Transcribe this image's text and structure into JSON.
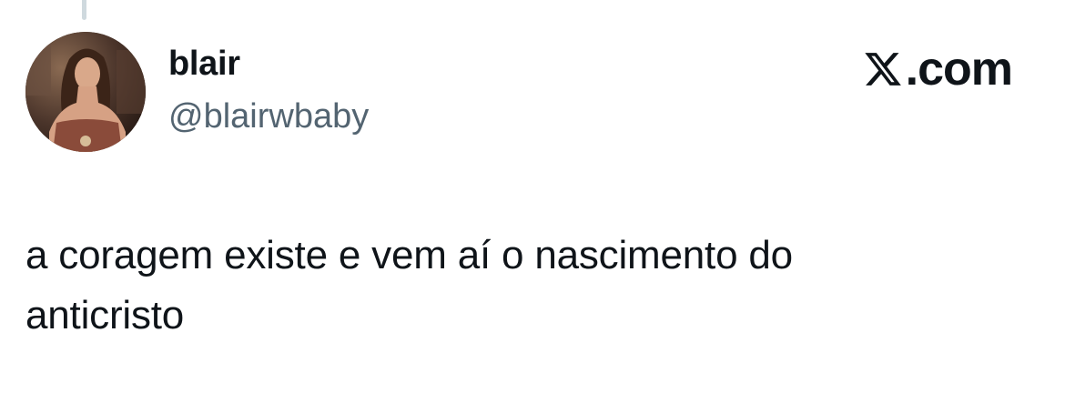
{
  "tweet": {
    "author": {
      "display_name": "blair",
      "handle": "@blairwbaby",
      "avatar_icon": "profile-photo"
    },
    "brand": {
      "icon": "x-logo-icon",
      "label": ".com"
    },
    "text_lines": [
      "a coragem existe e vem aí o nascimento do",
      "anticristo"
    ]
  },
  "colors": {
    "text_primary": "#0f1419",
    "text_secondary": "#536471",
    "thread_line": "#cfd9de",
    "background": "#ffffff"
  }
}
